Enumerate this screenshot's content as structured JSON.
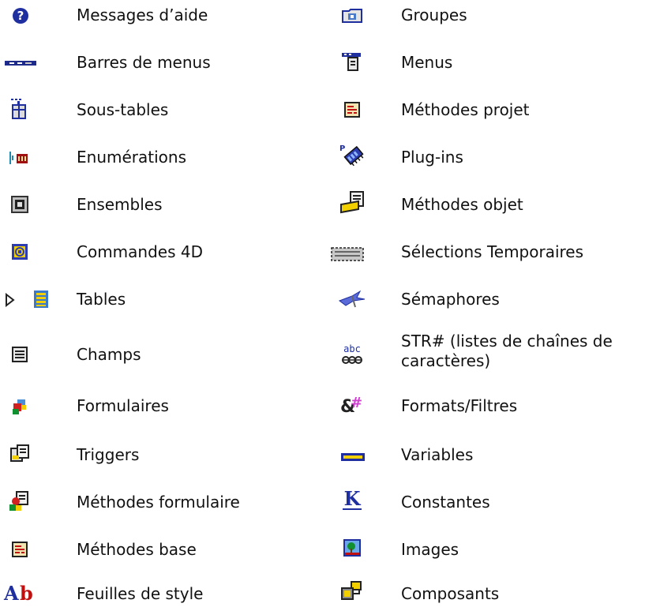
{
  "left": [
    {
      "icon": "help-icon",
      "label": "Messages d’aide"
    },
    {
      "icon": "menubar-icon",
      "label": "Barres de menus"
    },
    {
      "icon": "subtable-icon",
      "label": "Sous-tables"
    },
    {
      "icon": "enumeration-icon",
      "label": "Enumérations"
    },
    {
      "icon": "set-icon",
      "label": "Ensembles"
    },
    {
      "icon": "command-icon",
      "label": "Commandes 4D"
    },
    {
      "icon": "table-icon",
      "label": "Tables"
    },
    {
      "icon": "field-icon",
      "label": "Champs"
    },
    {
      "icon": "form-icon",
      "label": "Formulaires"
    },
    {
      "icon": "trigger-icon",
      "label": "Triggers"
    },
    {
      "icon": "form-method-icon",
      "label": "Méthodes formulaire"
    },
    {
      "icon": "database-method-icon",
      "label": "Méthodes base"
    },
    {
      "icon": "stylesheet-icon",
      "label": "Feuilles de style"
    }
  ],
  "right": [
    {
      "icon": "group-icon",
      "label": "Groupes"
    },
    {
      "icon": "menu-icon",
      "label": "Menus"
    },
    {
      "icon": "project-method-icon",
      "label": "Méthodes projet"
    },
    {
      "icon": "plugin-icon",
      "label": "Plug-ins"
    },
    {
      "icon": "object-method-icon",
      "label": "Méthodes objet"
    },
    {
      "icon": "named-selection-icon",
      "label": "Sélections Temporaires"
    },
    {
      "icon": "semaphore-icon",
      "label": "Sémaphores"
    },
    {
      "icon": "str-list-icon",
      "label": "STR# (listes de chaînes de caractères)"
    },
    {
      "icon": "format-filter-icon",
      "label": "Formats/Filtres"
    },
    {
      "icon": "variable-icon",
      "label": "Variables"
    },
    {
      "icon": "constant-icon",
      "label": "Constantes"
    },
    {
      "icon": "picture-icon",
      "label": "Images"
    },
    {
      "icon": "component-icon",
      "label": "Composants"
    }
  ]
}
